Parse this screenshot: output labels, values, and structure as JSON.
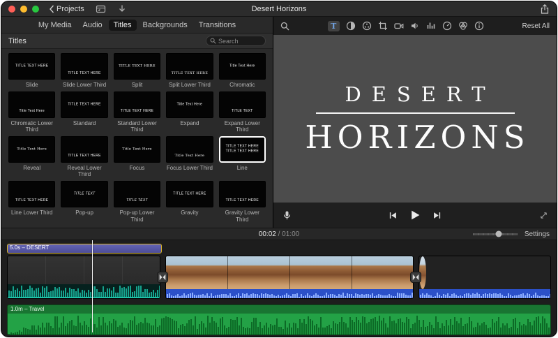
{
  "titlebar": {
    "back_label": "Projects",
    "window_title": "Desert Horizons"
  },
  "tabs": [
    {
      "label": "My Media",
      "active": false
    },
    {
      "label": "Audio",
      "active": false
    },
    {
      "label": "Titles",
      "active": true
    },
    {
      "label": "Backgrounds",
      "active": false
    },
    {
      "label": "Transitions",
      "active": false
    }
  ],
  "browser": {
    "header": "Titles",
    "search_placeholder": "Search",
    "titles": [
      {
        "name": "Slide",
        "thumb": "TITLE TEXT HERE",
        "pos": "center"
      },
      {
        "name": "Slide Lower Third",
        "thumb": "TITLE TEXT HERE",
        "pos": "lower"
      },
      {
        "name": "Split",
        "thumb": "TITLE TEXT HERE",
        "pos": "center",
        "serif": true
      },
      {
        "name": "Split Lower Third",
        "thumb": "TITLE TEXT HERE",
        "pos": "lower",
        "serif": true
      },
      {
        "name": "Chromatic",
        "thumb": "Title Text Here",
        "pos": "center"
      },
      {
        "name": "Chromatic Lower Third",
        "thumb": "Title Text Here",
        "pos": "lower"
      },
      {
        "name": "Standard",
        "thumb": "TITLE TEXT HERE",
        "pos": "center"
      },
      {
        "name": "Standard Lower Third",
        "thumb": "TITLE TEXT HERE",
        "pos": "lower"
      },
      {
        "name": "Expand",
        "thumb": "Title Text Here",
        "pos": "center"
      },
      {
        "name": "Expand Lower Third",
        "thumb": "TITLE TEXT",
        "pos": "lower"
      },
      {
        "name": "Reveal",
        "thumb": "Title Text Here",
        "pos": "center",
        "serif": true
      },
      {
        "name": "Reveal Lower Third",
        "thumb": "TITLE TEXT HERE",
        "pos": "lower"
      },
      {
        "name": "Focus",
        "thumb": "Title Text Here",
        "pos": "center",
        "serif": true
      },
      {
        "name": "Focus Lower Third",
        "thumb": "Title Text Here",
        "pos": "lower",
        "serif": true
      },
      {
        "name": "Line",
        "thumb": "TITLE TEXT HERE\nTITLE TEXT HERE",
        "pos": "center",
        "selected": true
      },
      {
        "name": "Line Lower Third",
        "thumb": "TITLE TEXT HERE",
        "pos": "lower"
      },
      {
        "name": "Pop-up",
        "thumb": "TITLE TEXT",
        "pos": "center",
        "italic": true
      },
      {
        "name": "Pop-up Lower Third",
        "thumb": "TITLE TEXT",
        "pos": "lower",
        "italic": true
      },
      {
        "name": "Gravity",
        "thumb": "TITLE TEXT HERE",
        "pos": "center"
      },
      {
        "name": "Gravity Lower Third",
        "thumb": "TITLE TEXT HERE",
        "pos": "lower"
      }
    ]
  },
  "viewer": {
    "reset_label": "Reset All",
    "preview": {
      "line1": "DESERT",
      "line2": "HORIZONS"
    }
  },
  "timeline_bar": {
    "timecode_current": "00:02",
    "timecode_separator": " / ",
    "timecode_total": "01:00",
    "settings_label": "Settings"
  },
  "timeline": {
    "title_clip_label": "5.0s – DESERT",
    "audio_clip_label": "1.0m – Travel"
  },
  "colors": {
    "accent_blue": "#79b0f5",
    "selection_yellow": "#d7b223",
    "title_clip": "#4c4c97",
    "audio_green": "#23a246",
    "music_strip_blue": "#2b50c8",
    "waveform_teal": "#16a38e"
  }
}
